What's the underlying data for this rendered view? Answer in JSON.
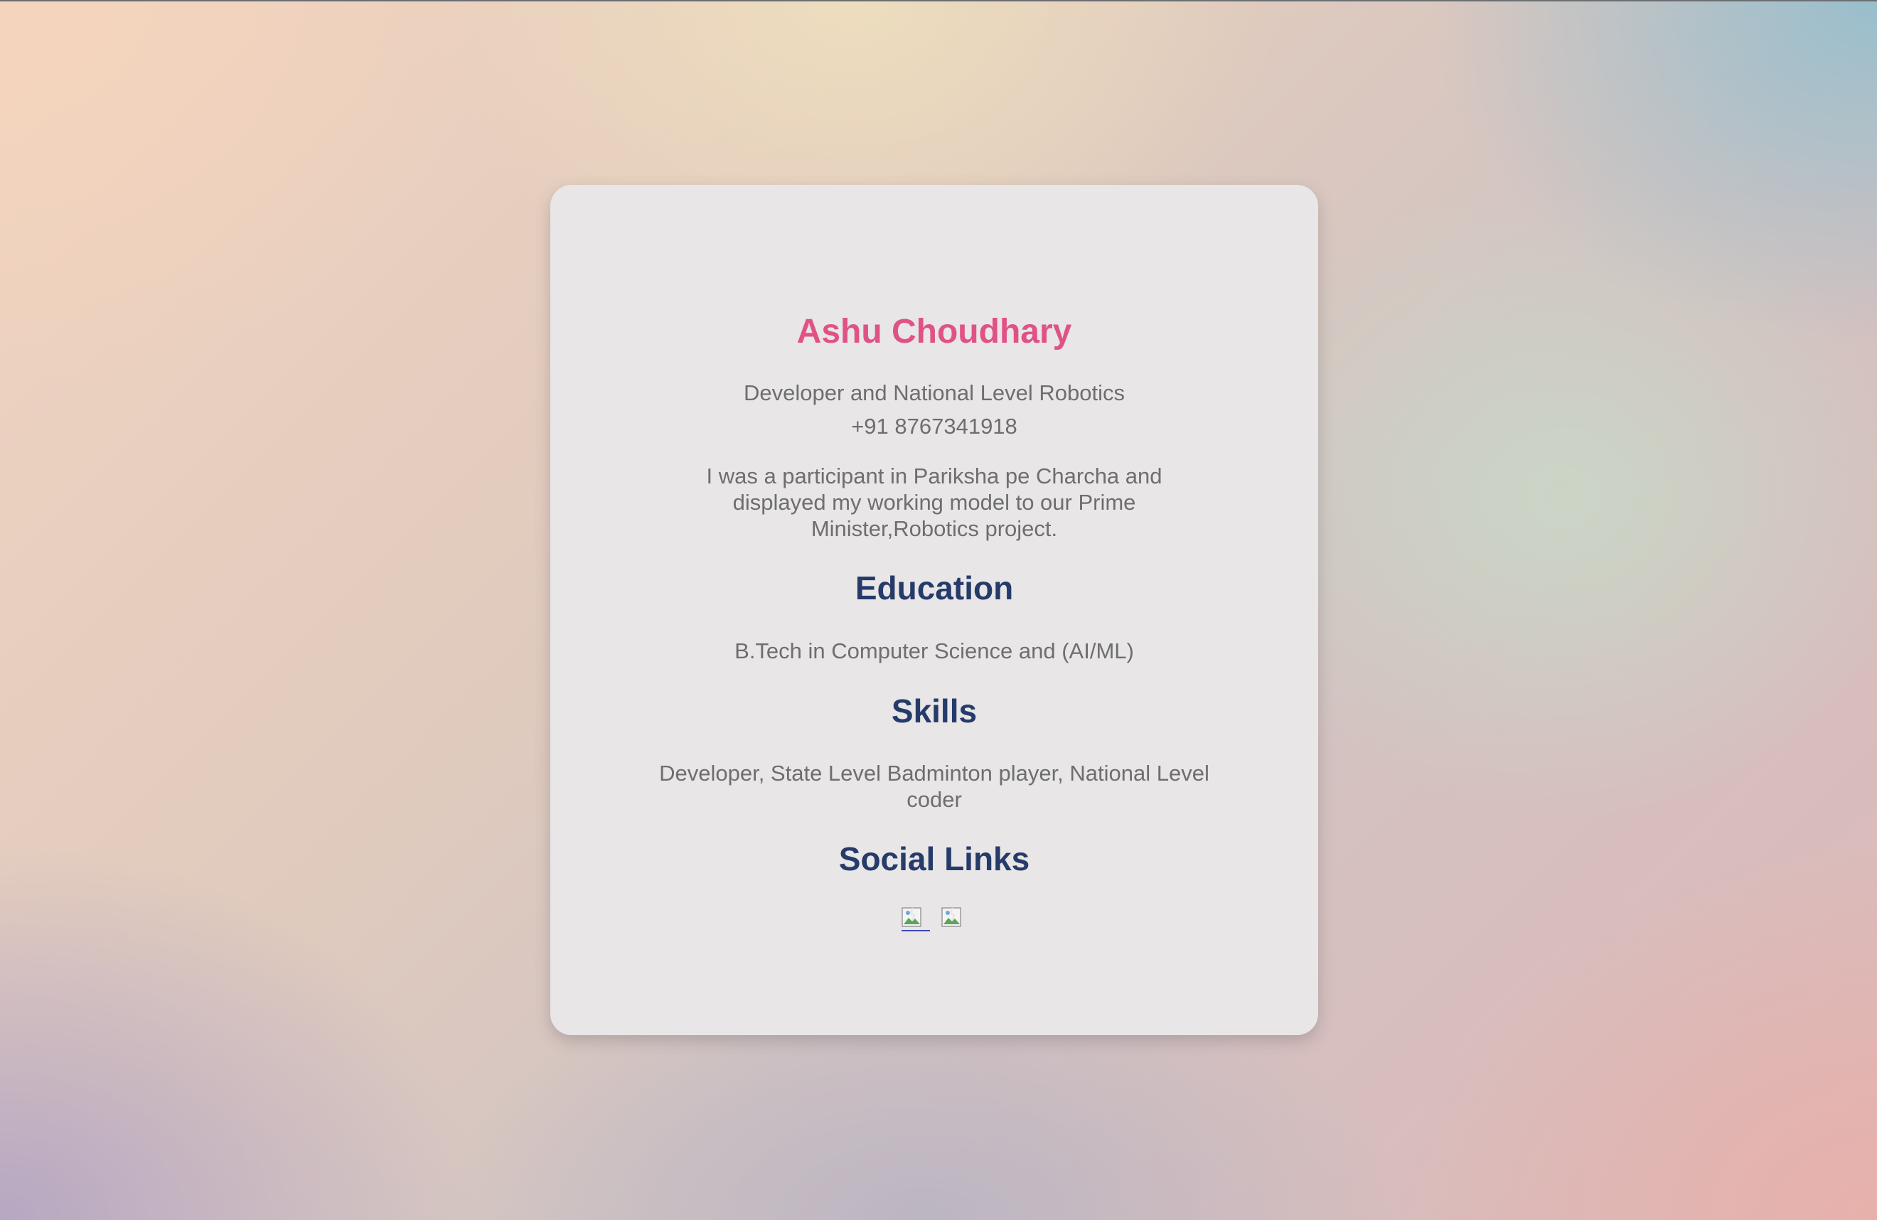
{
  "profile": {
    "name": "Ashu Choudhary",
    "role": "Developer and National Level Robotics",
    "phone": "+91 8767341918",
    "bio": "I was a participant in Pariksha pe Charcha and displayed my working model to our Prime Minister,Robotics project."
  },
  "education": {
    "heading": "Education",
    "text": "B.Tech in Computer Science and (AI/ML)"
  },
  "skills": {
    "heading": "Skills",
    "text": "Developer, State Level Badminton player, National Level coder"
  },
  "social": {
    "heading": "Social Links",
    "links": [
      {
        "icon": "broken-image-icon"
      },
      {
        "icon": "broken-image-icon"
      }
    ]
  },
  "colors": {
    "name": "#e05286",
    "heading": "#263b6a",
    "body_text": "#6e6e6e",
    "card": "#e8e6e7"
  }
}
